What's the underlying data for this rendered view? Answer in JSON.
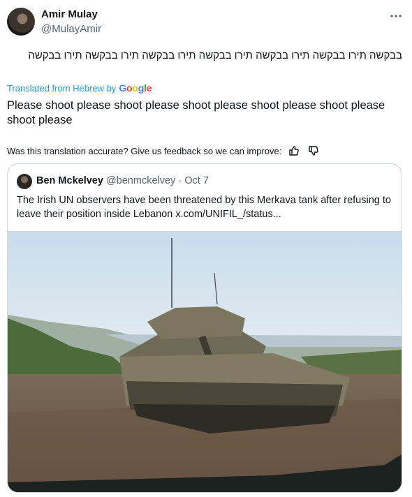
{
  "post": {
    "author_name": "Amir Mulay",
    "author_handle": "@MulayAmir",
    "hebrew_text": "בבקשה תירו בבקשה תירו בבקשה תירו בבקשה תירו בבקשה תירו בבקשה תירו בבקשה",
    "translated_from": "Translated from Hebrew by",
    "translator_logo": "Google",
    "translation": "Please shoot please shoot please shoot please shoot please shoot please shoot please",
    "feedback_prompt": "Was this translation accurate? Give us feedback so we can improve:",
    "icons": {
      "more": "more-horizontal-icon",
      "thumbs_up": "thumbs-up-icon",
      "thumbs_down": "thumbs-down-icon"
    }
  },
  "quoted": {
    "author_name": "Ben Mckelvey",
    "author_handle": "@benmckelvey",
    "date": "Oct 7",
    "text": "The Irish UN observers have been threatened by this Merkava tank after refusing to leave their position inside Lebanon  x.com/UNIFIL_/status..."
  },
  "colors": {
    "link": "#1d9bf0",
    "secondary_text": "#536471",
    "border": "#cfd9de",
    "google_blue": "#4285f4",
    "google_red": "#ea4335",
    "google_yellow": "#fbbc05",
    "google_green": "#34a853"
  }
}
